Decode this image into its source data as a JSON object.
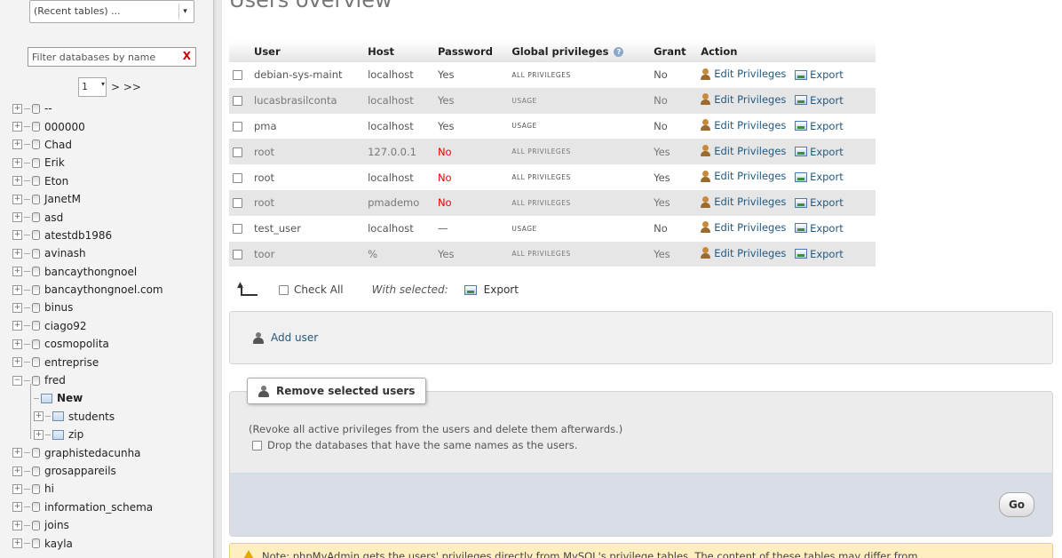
{
  "navigation": {
    "recent_tables": "(Recent tables) ...",
    "filter_placeholder": "Filter databases by name",
    "filter_clear": "X",
    "page_number": "1",
    "page_next": "> >>",
    "databases": [
      {
        "name": "--"
      },
      {
        "name": "000000"
      },
      {
        "name": "Chad"
      },
      {
        "name": "Erik"
      },
      {
        "name": "Eton"
      },
      {
        "name": "JanetM"
      },
      {
        "name": "asd"
      },
      {
        "name": "atestdb1986"
      },
      {
        "name": "avinash"
      },
      {
        "name": "bancaythongnoel"
      },
      {
        "name": "bancaythongnoel.com"
      },
      {
        "name": "binus"
      },
      {
        "name": "ciago92"
      },
      {
        "name": "cosmopolita"
      },
      {
        "name": "entreprise"
      },
      {
        "name": "fred"
      }
    ],
    "fred_children": [
      "New",
      "students",
      "zip"
    ],
    "databases_after": [
      {
        "name": "graphistedacunha"
      },
      {
        "name": "grosappareils"
      },
      {
        "name": "hi"
      },
      {
        "name": "information_schema"
      },
      {
        "name": "joins"
      },
      {
        "name": "kayla"
      }
    ]
  },
  "main": {
    "heading": "Users overview",
    "columns": [
      "User",
      "Host",
      "Password",
      "Global privileges",
      "Grant",
      "Action"
    ],
    "edit_label": "Edit Privileges",
    "export_label": "Export",
    "users": [
      {
        "user": "debian-sys-maint",
        "host": "localhost",
        "password": "Yes",
        "privileges": "ALL PRIVILEGES",
        "grant": "No"
      },
      {
        "user": "lucasbrasilconta",
        "host": "localhost",
        "password": "Yes",
        "privileges": "USAGE",
        "grant": "No"
      },
      {
        "user": "pma",
        "host": "localhost",
        "password": "Yes",
        "privileges": "USAGE",
        "grant": "No"
      },
      {
        "user": "root",
        "host": "127.0.0.1",
        "password": "No",
        "privileges": "ALL PRIVILEGES",
        "grant": "Yes"
      },
      {
        "user": "root",
        "host": "localhost",
        "password": "No",
        "privileges": "ALL PRIVILEGES",
        "grant": "Yes"
      },
      {
        "user": "root",
        "host": "pmademo",
        "password": "No",
        "privileges": "ALL PRIVILEGES",
        "grant": "Yes"
      },
      {
        "user": "test_user",
        "host": "localhost",
        "password": "—",
        "privileges": "USAGE",
        "grant": "No"
      },
      {
        "user": "toor",
        "host": "%",
        "password": "Yes",
        "privileges": "ALL PRIVILEGES",
        "grant": "Yes"
      }
    ],
    "bulk": {
      "check_all": "Check All",
      "with_selected": "With selected:",
      "export": "Export"
    },
    "add_user": "Add user",
    "remove": {
      "legend": "Remove selected users",
      "note": "(Revoke all active privileges from the users and delete them afterwards.)",
      "drop_label": "Drop the databases that have the same names as the users.",
      "go": "Go"
    },
    "notice": "Note: phpMyAdmin gets the users' privileges directly from MySQL's privilege tables. The content of these tables may differ from"
  },
  "colors": {
    "link": "#235a81",
    "danger": "#e00000",
    "row_alt": "#e6e6e6",
    "notice_bg": "#ffefc0"
  }
}
